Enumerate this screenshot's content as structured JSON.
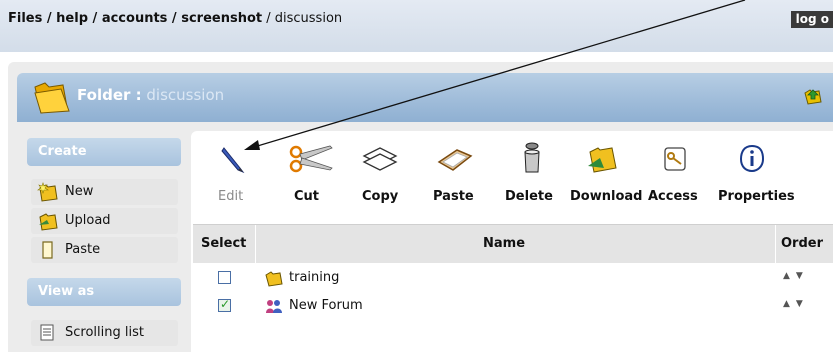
{
  "breadcrumb": {
    "files": "Files",
    "sep1": " / ",
    "help": "help",
    "sep2": " / ",
    "accounts": "accounts",
    "sep3": " / ",
    "screenshot": "screenshot",
    "sep4": " / ",
    "current": "discussion"
  },
  "logout_label": "log o",
  "folder": {
    "label": "Folder :",
    "name": "discussion"
  },
  "sidebar": {
    "create_title": "Create",
    "create_items": [
      {
        "label": "New",
        "icon": "new-folder-icon"
      },
      {
        "label": "Upload",
        "icon": "upload-icon"
      },
      {
        "label": "Paste",
        "icon": "paste-page-icon"
      }
    ],
    "view_title": "View as",
    "view_items": [
      {
        "label": "Scrolling list",
        "icon": "list-icon"
      }
    ]
  },
  "toolbar": {
    "edit": "Edit",
    "cut": "Cut",
    "copy": "Copy",
    "paste": "Paste",
    "delete": "Delete",
    "download": "Download",
    "access": "Access",
    "properties": "Properties"
  },
  "table": {
    "headers": {
      "select": "Select",
      "name": "Name",
      "order": "Order"
    },
    "rows": [
      {
        "name": "training",
        "checked": false,
        "icon": "folder-icon"
      },
      {
        "name": "New Forum",
        "checked": true,
        "icon": "forum-icon"
      }
    ]
  },
  "colors": {
    "header_bar": "#d8e1ec",
    "folder_bar": "#9ebbd9",
    "panel_bg": "#ececec",
    "dim_label": "#8a8a8a"
  }
}
